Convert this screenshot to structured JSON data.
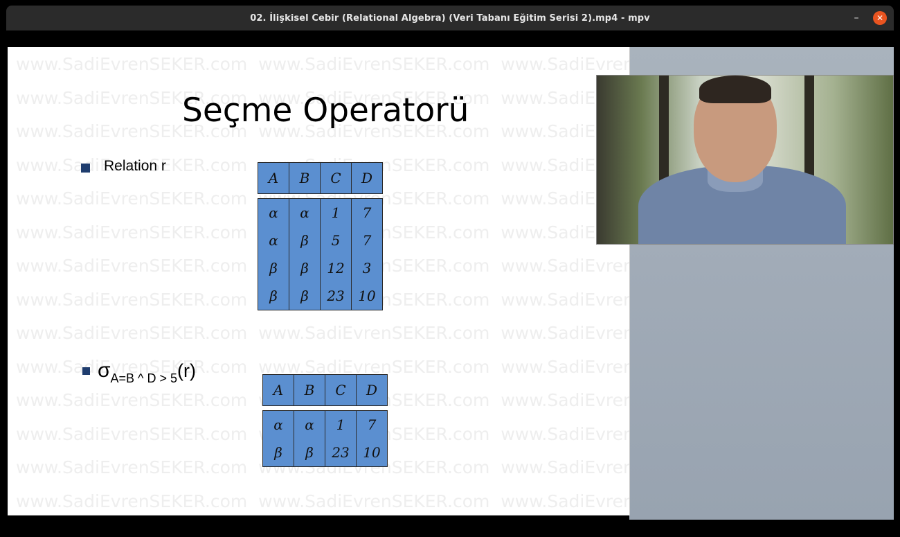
{
  "window": {
    "title": "02. İlişkisel Cebir (Relational Algebra) (Veri Tabanı Eğitim Serisi 2).mp4 - mpv",
    "minimize_glyph": "–",
    "close_glyph": "✕",
    "accent_close": "#e95420"
  },
  "slide": {
    "watermark": "www.SadiEvrenSEKER.com",
    "title": "Seçme Operatorü",
    "bullet1_label": "Relation r",
    "bullet2": {
      "sigma": "σ",
      "subscript": "A=B ^ D > 5",
      "argument": "(r)"
    },
    "relation_r": {
      "columns": [
        "A",
        "B",
        "C",
        "D"
      ],
      "rows": [
        [
          "α",
          "α",
          "1",
          "7"
        ],
        [
          "α",
          "β",
          "5",
          "7"
        ],
        [
          "β",
          "β",
          "12",
          "3"
        ],
        [
          "β",
          "β",
          "23",
          "10"
        ]
      ]
    },
    "result": {
      "columns": [
        "A",
        "B",
        "C",
        "D"
      ],
      "rows": [
        [
          "α",
          "α",
          "1",
          "7"
        ],
        [
          "β",
          "β",
          "23",
          "10"
        ]
      ]
    },
    "table_color": "#5b8fd0",
    "bullet_color": "#1f3d6e"
  },
  "webcam": {
    "description_icon": "presenter-video"
  }
}
